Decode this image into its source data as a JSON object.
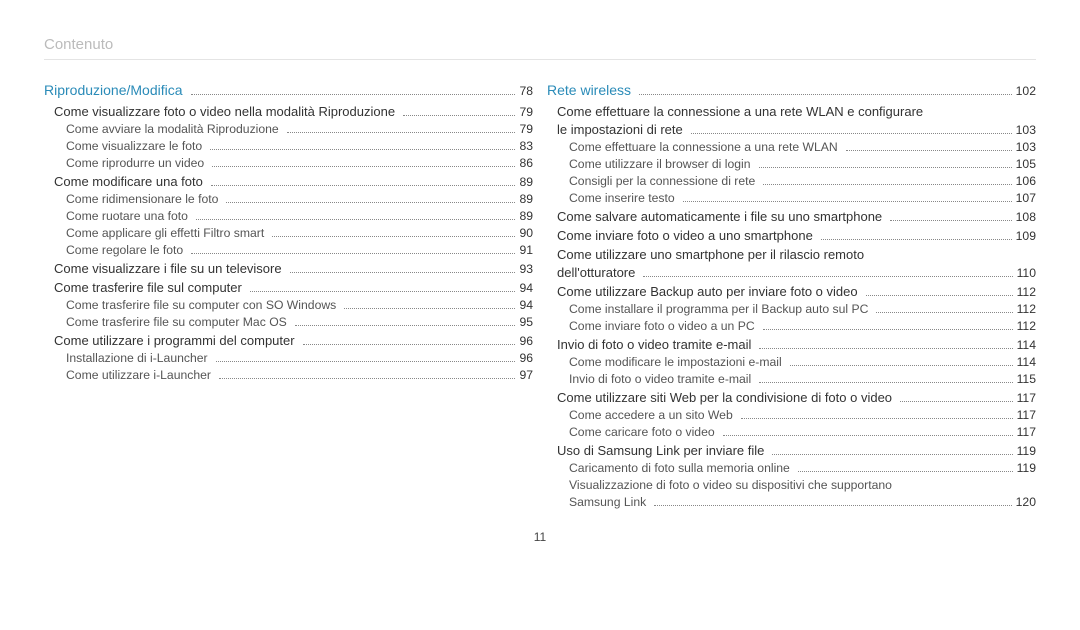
{
  "header": "Contenuto",
  "pageNumber": "11",
  "left": {
    "chapter": {
      "title": "Riproduzione/Modiﬁca",
      "page": "78"
    },
    "rows": [
      {
        "level": 1,
        "title": "Come visualizzare foto o video nella modalità Riproduzione",
        "page": "79"
      },
      {
        "level": 2,
        "title": "Come avviare la modalità Riproduzione",
        "page": "79"
      },
      {
        "level": 2,
        "title": "Come visualizzare le foto",
        "page": "83"
      },
      {
        "level": 2,
        "title": "Come riprodurre un video",
        "page": "86"
      },
      {
        "level": 1,
        "title": "Come modiﬁcare una foto",
        "page": "89"
      },
      {
        "level": 2,
        "title": "Come ridimensionare le foto",
        "page": "89"
      },
      {
        "level": 2,
        "title": "Come ruotare una foto",
        "page": "89"
      },
      {
        "level": 2,
        "title": "Come applicare gli effetti Filtro smart",
        "page": "90"
      },
      {
        "level": 2,
        "title": "Come regolare le foto",
        "page": "91"
      },
      {
        "level": 1,
        "title": "Come visualizzare i ﬁle su un televisore",
        "page": "93"
      },
      {
        "level": 1,
        "title": "Come trasferire ﬁle sul computer",
        "page": "94"
      },
      {
        "level": 2,
        "title": "Come trasferire ﬁle su computer con SO Windows",
        "page": "94"
      },
      {
        "level": 2,
        "title": "Come trasferire ﬁle su computer Mac OS",
        "page": "95"
      },
      {
        "level": 1,
        "title": "Come utilizzare i programmi del computer",
        "page": "96"
      },
      {
        "level": 2,
        "title": "Installazione di i-Launcher",
        "page": "96"
      },
      {
        "level": 2,
        "title": "Come utilizzare i-Launcher",
        "page": "97"
      }
    ]
  },
  "right": {
    "chapter": {
      "title": "Rete wireless",
      "page": "102"
    },
    "rows": [
      {
        "level": 1,
        "title": "Come effettuare la connessione a una rete WLAN e conﬁgurare",
        "page": ""
      },
      {
        "level": "1c",
        "title": "le impostazioni di rete",
        "page": "103"
      },
      {
        "level": 2,
        "title": "Come effettuare la connessione a una rete WLAN",
        "page": "103"
      },
      {
        "level": 2,
        "title": "Come utilizzare il browser di login",
        "page": "105"
      },
      {
        "level": 2,
        "title": "Consigli per la connessione di rete",
        "page": "106"
      },
      {
        "level": 2,
        "title": "Come inserire testo",
        "page": "107"
      },
      {
        "level": 1,
        "title": "Come salvare automaticamente i ﬁle su uno smartphone",
        "page": "108"
      },
      {
        "level": 1,
        "title": "Come inviare foto o video a uno smartphone",
        "page": "109"
      },
      {
        "level": 1,
        "title": "Come utilizzare uno smartphone per il rilascio remoto",
        "page": ""
      },
      {
        "level": "1c",
        "title": "dell'otturatore",
        "page": "110"
      },
      {
        "level": 1,
        "title": "Come utilizzare Backup auto per inviare foto o video",
        "page": "112"
      },
      {
        "level": 2,
        "title": "Come installare il programma per il Backup auto sul PC",
        "page": "112"
      },
      {
        "level": 2,
        "title": "Come inviare foto o video a un PC",
        "page": "112"
      },
      {
        "level": 1,
        "title": "Invio di foto o video tramite e-mail",
        "page": "114"
      },
      {
        "level": 2,
        "title": "Come modiﬁcare le impostazioni e-mail",
        "page": "114"
      },
      {
        "level": 2,
        "title": "Invio di foto o video tramite e-mail",
        "page": "115"
      },
      {
        "level": 1,
        "title": "Come utilizzare siti Web per la condivisione di foto o video",
        "page": "117"
      },
      {
        "level": 2,
        "title": "Come accedere a un sito Web",
        "page": "117"
      },
      {
        "level": 2,
        "title": "Come caricare foto o video",
        "page": "117"
      },
      {
        "level": 1,
        "title": "Uso di Samsung Link per inviare ﬁle",
        "page": "119"
      },
      {
        "level": 2,
        "title": "Caricamento di foto sulla memoria online",
        "page": "119"
      },
      {
        "level": 2,
        "title": "Visualizzazione di foto o video su dispositivi che supportano",
        "page": ""
      },
      {
        "level": "2c",
        "title": "Samsung Link",
        "page": "120"
      }
    ]
  }
}
